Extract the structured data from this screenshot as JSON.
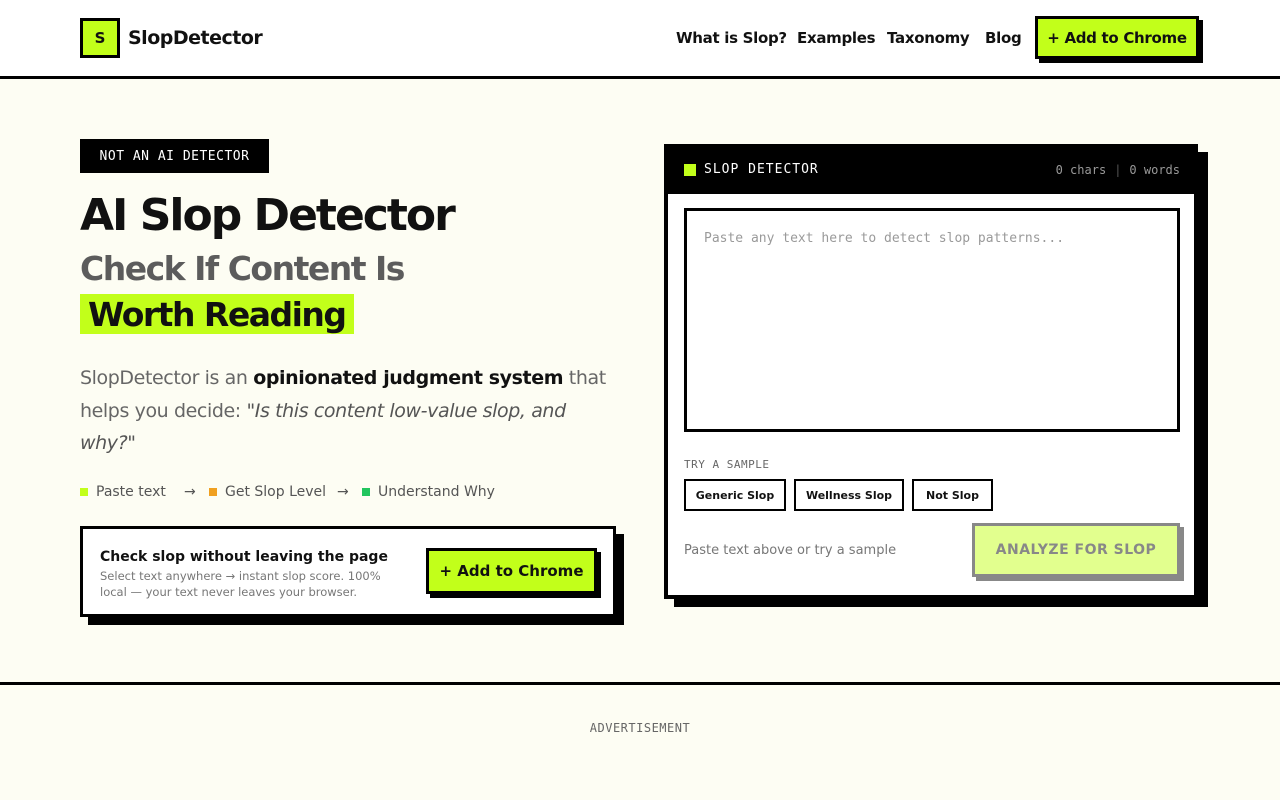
{
  "header": {
    "logo_letter": "S",
    "brand": "SlopDetector",
    "nav": [
      "What is Slop?",
      "Examples",
      "Taxonomy",
      "Blog"
    ],
    "cta": "+ Add to Chrome"
  },
  "hero": {
    "badge": "NOT AN AI DETECTOR",
    "title": "AI Slop Detector",
    "subtitle": "Check If Content Is",
    "highlight": "Worth Reading",
    "lead_prefix": "SlopDetector is an ",
    "lead_bold": "opinionated judgment system",
    "lead_mid": " that helps you decide: ",
    "lead_italic": "\"Is this content low-value slop, and why?\"",
    "steps": [
      {
        "label": "Paste text",
        "color": "#c2ff1a"
      },
      {
        "label": "Get Slop Level",
        "color": "#f0a020"
      },
      {
        "label": "Understand Why",
        "color": "#22c55e"
      }
    ],
    "arrow": "→"
  },
  "cta_card": {
    "title": "Check slop without leaving the page",
    "subtitle": "Select text anywhere → instant slop score. 100% local — your text never leaves your browser.",
    "button": "+ Add to Chrome"
  },
  "detector": {
    "title": "SLOP DETECTOR",
    "chars": "0 chars",
    "separator": "|",
    "words": "0 words",
    "placeholder": "Paste any text here to detect slop patterns...",
    "try_label": "TRY A SAMPLE",
    "samples": [
      "Generic Slop",
      "Wellness Slop",
      "Not Slop"
    ],
    "hint": "Paste text above or try a sample",
    "analyze": "ANALYZE FOR SLOP"
  },
  "footer": {
    "ad_label": "ADVERTISEMENT"
  },
  "colors": {
    "accent": "#c2ff1a",
    "background": "#fdfdf3",
    "ink": "#000000"
  }
}
